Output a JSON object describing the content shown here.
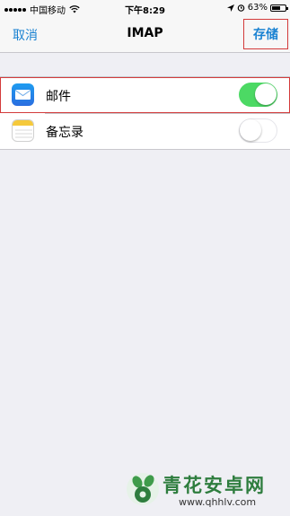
{
  "status_bar": {
    "carrier": "中国移动",
    "time": "下午8:29",
    "battery": "63%",
    "battery_level": 0.63
  },
  "nav": {
    "cancel_label": "取消",
    "title": "IMAP",
    "save_label": "存储"
  },
  "list": {
    "items": [
      {
        "label": "邮件",
        "icon": "mail-icon",
        "enabled": true
      },
      {
        "label": "备忘录",
        "icon": "notes-icon",
        "enabled": false
      }
    ]
  },
  "watermark": {
    "title": "青花安卓网",
    "url": "www.qhhlv.com"
  },
  "colors": {
    "accent": "#1a82d2",
    "toggle_on": "#4cd964",
    "highlight": "#d33b3b"
  }
}
